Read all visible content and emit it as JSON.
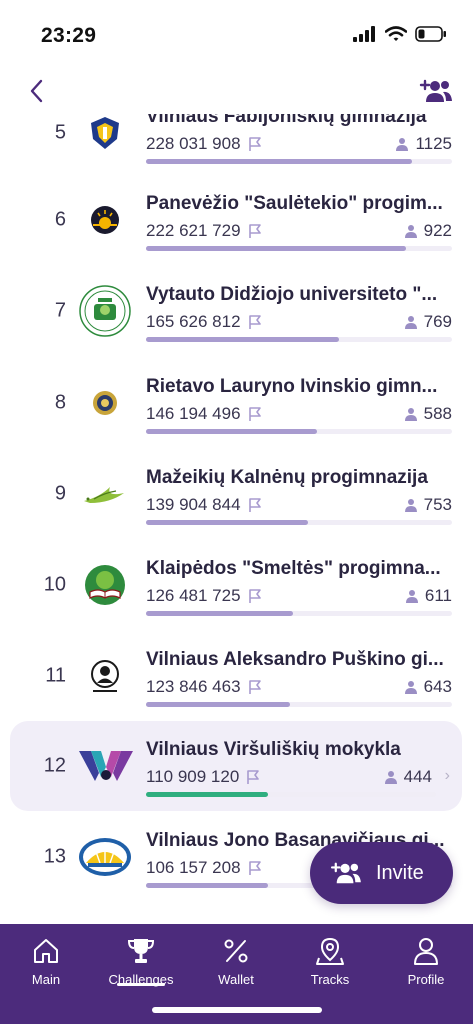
{
  "status": {
    "time": "23:29"
  },
  "colors": {
    "accent": "#4c2b7c",
    "progress": "#a89bcf",
    "progress_highlight": "#2fae7f",
    "highlight_bg": "#f1eef8"
  },
  "leaderboard": [
    {
      "rank": "5",
      "name": "Vilniaus Fabijoniškių gimnazija",
      "score": "228 031 908",
      "members": "1125",
      "progress": 0.87,
      "logo": "shield-emblem"
    },
    {
      "rank": "6",
      "name": "Panevėžio \"Saulėtekio\" progim...",
      "score": "222 621 729",
      "members": "922",
      "progress": 0.85,
      "logo": "sun-emblem"
    },
    {
      "rank": "7",
      "name": "Vytauto Didžiojo universiteto \"...",
      "score": "165 626 812",
      "members": "769",
      "progress": 0.63,
      "logo": "green-crest"
    },
    {
      "rank": "8",
      "name": "Rietavo Lauryno Ivinskio gimn...",
      "score": "146 194 496",
      "members": "588",
      "progress": 0.56,
      "logo": "round-seal"
    },
    {
      "rank": "9",
      "name": "Mažeikių Kalnėnų progimnazija",
      "score": "139 904 844",
      "members": "753",
      "progress": 0.53,
      "logo": "bird-logo"
    },
    {
      "rank": "10",
      "name": "Klaipėdos \"Smeltės\" progimna...",
      "score": "126 481 725",
      "members": "611",
      "progress": 0.48,
      "logo": "book-emblem"
    },
    {
      "rank": "11",
      "name": "Vilniaus Aleksandro Puškino gi...",
      "score": "123 846 463",
      "members": "643",
      "progress": 0.47,
      "logo": "portrait-emblem"
    },
    {
      "rank": "12",
      "name": "Vilniaus Viršuliškių mokykla",
      "score": "110 909 120",
      "members": "444",
      "progress": 0.42,
      "logo": "v-logo",
      "highlight": true
    },
    {
      "rank": "13",
      "name": "Vilniaus Jono Basanavičiaus gi...",
      "score": "106 157 208",
      "members": "",
      "progress": 0.4,
      "logo": "sunrise-emblem"
    }
  ],
  "invite": {
    "label": "Invite"
  },
  "tabs": [
    {
      "label": "Main",
      "icon": "home-icon"
    },
    {
      "label": "Challenges",
      "icon": "trophy-icon",
      "active": true
    },
    {
      "label": "Wallet",
      "icon": "percent-icon"
    },
    {
      "label": "Tracks",
      "icon": "map-pin-icon"
    },
    {
      "label": "Profile",
      "icon": "person-icon"
    }
  ]
}
